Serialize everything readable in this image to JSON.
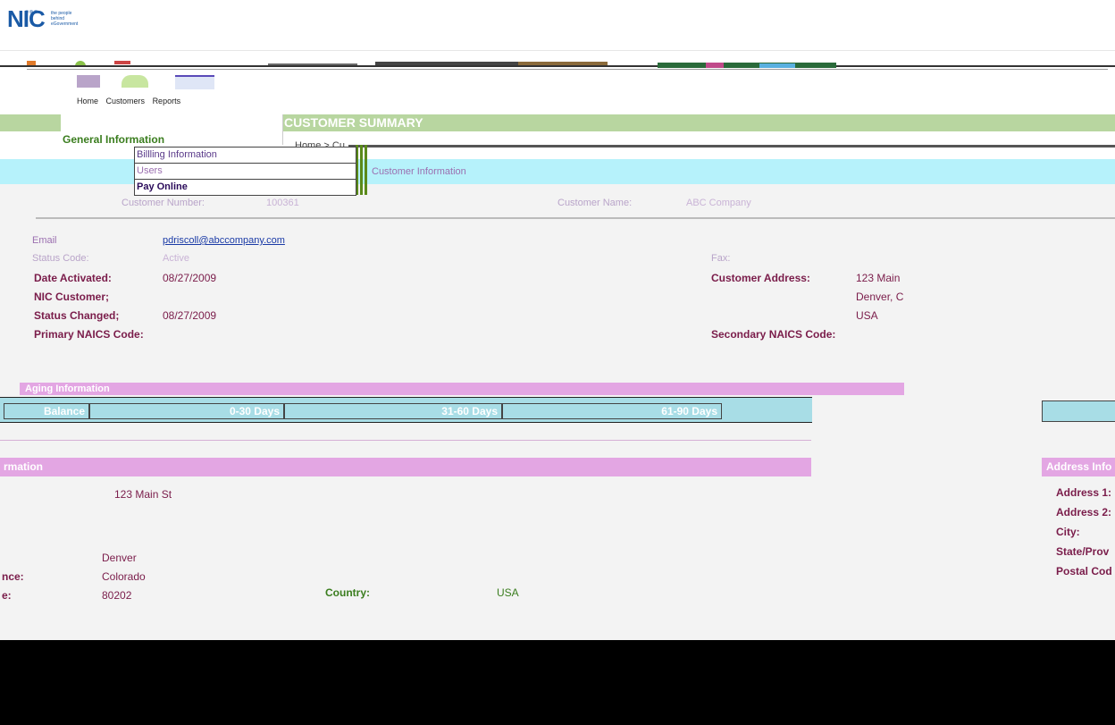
{
  "logo": {
    "mark": "NIC",
    "tagline": "the people behind eGovernment"
  },
  "nav": {
    "home": "Home",
    "customers": "Customers",
    "reports": "Reports"
  },
  "header": {
    "title": "CUSTOMER SUMMARY",
    "section": "General Information",
    "breadcrumb": "Home > Cu"
  },
  "menu": {
    "billing": "Billling Information",
    "users": "Users",
    "pay": "Pay Online"
  },
  "customer": {
    "section_label": "Customer Information",
    "number_label": "Customer Number:",
    "number_value": "100361",
    "name_label": "Customer Name:",
    "name_value": "ABC Company",
    "email_label": "Email",
    "email_value": "pdriscoll@abccompany.com",
    "status_code_label": "Status Code:",
    "status_code_value": "Active",
    "fax_label": "Fax:",
    "date_activated_label": "Date Activated:",
    "date_activated_value": "08/27/2009",
    "nic_customer_label": "NIC Customer;",
    "status_changed_label": "Status Changed;",
    "status_changed_value": "08/27/2009",
    "primary_naics_label": "Primary NAICS Code:",
    "address_label": "Customer Address:",
    "address_lines": [
      "123 Main",
      "Denver, C",
      "USA"
    ],
    "secondary_naics_label": "Secondary NAICS Code:"
  },
  "aging": {
    "title": "Aging Information",
    "columns": [
      "Balance",
      "0-30 Days",
      "31-60 Days",
      "61-90 Days"
    ]
  },
  "address": {
    "title": "rmation",
    "street": "123 Main St",
    "city": "Denver",
    "province_label": "nce:",
    "province": "Colorado",
    "postal_label": "e:",
    "postal": "80202",
    "country_label": "Country:",
    "country": "USA"
  },
  "address_right": {
    "title": "Address Info",
    "labels": [
      "Address 1:",
      "Address 2:",
      "City:",
      "State/Prov",
      "Postal Cod"
    ]
  }
}
